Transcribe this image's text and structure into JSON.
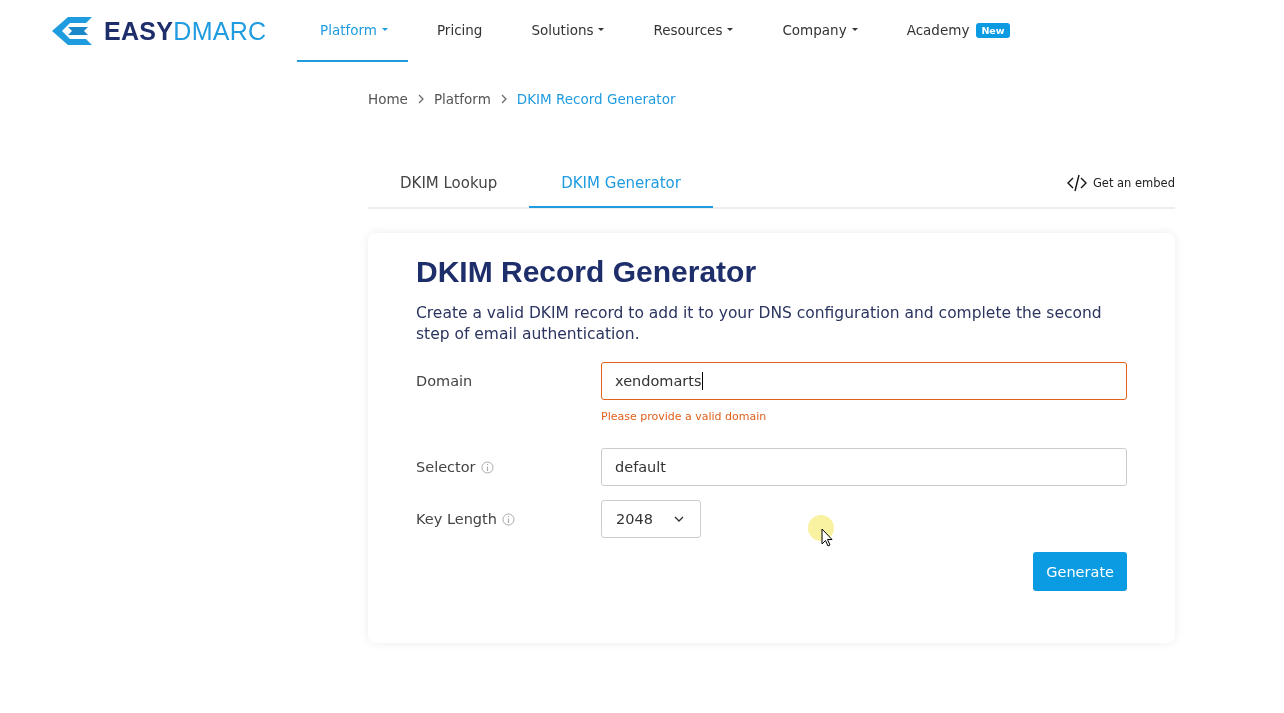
{
  "nav": {
    "logo": {
      "strong": "EASY",
      "light": "DMARC"
    },
    "items": [
      {
        "label": "Platform",
        "selected": true,
        "dropdown": true
      },
      {
        "label": "Pricing",
        "selected": false,
        "dropdown": false
      },
      {
        "label": "Solutions",
        "selected": false,
        "dropdown": true
      },
      {
        "label": "Resources",
        "selected": false,
        "dropdown": true
      },
      {
        "label": "Company",
        "selected": false,
        "dropdown": true
      },
      {
        "label": "Academy",
        "selected": false,
        "dropdown": false,
        "badge": "New"
      }
    ]
  },
  "breadcrumb": [
    {
      "label": "Home",
      "current": false
    },
    {
      "label": "Platform",
      "current": false
    },
    {
      "label": "DKIM Record Generator",
      "current": true
    }
  ],
  "tabs": [
    {
      "label": "DKIM Lookup",
      "selected": false
    },
    {
      "label": "DKIM Generator",
      "selected": true
    }
  ],
  "embed_link": "Get an embed",
  "card": {
    "title": "DKIM Record Generator",
    "description": "Create a valid DKIM record to add it to your DNS configuration and complete the second step of email authentication.",
    "fields": [
      {
        "kind": "text",
        "label": "Domain",
        "value": "xendomarts",
        "focused": true,
        "info": false,
        "error": "Please provide a valid domain"
      },
      {
        "kind": "text",
        "label": "Selector",
        "value": "default",
        "focused": false,
        "info": true
      },
      {
        "kind": "select",
        "label": "Key Length",
        "value": "2048",
        "info": true
      }
    ],
    "button": "Generate"
  }
}
